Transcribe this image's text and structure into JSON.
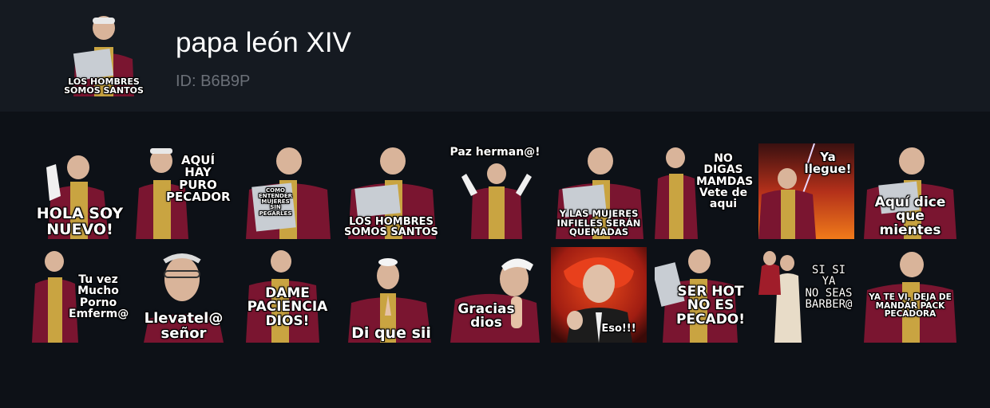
{
  "pack": {
    "title": "papa león XIV",
    "id_label": "ID: B6B9P",
    "cover_caption": "LOS HOMBRES\nSOMOS SANTOS"
  },
  "stickers": [
    {
      "caption": "HOLA SOY\nNUEVO!",
      "icon": "waving-pope"
    },
    {
      "caption": "AQUÍ HAY\nPURO\nPECADOR",
      "icon": "pope-pointing"
    },
    {
      "caption": "COMO\nENTENDER\nMUJERES\nSIN\nPEGARLES",
      "icon": "pope-reading"
    },
    {
      "caption": "LOS HOMBRES\nSOMOS SANTOS",
      "icon": "pope-reading"
    },
    {
      "caption": "Paz herman@!",
      "icon": "pope-arms-raised"
    },
    {
      "caption": "Y LAS MUJERES\nINFIELES SERÁN\nQUEMADAS",
      "icon": "pope-reading"
    },
    {
      "caption": "NO\nDIGAS\nMAMDAS\nVete de\naqui",
      "icon": "pope-standing"
    },
    {
      "caption": "Ya\nllegue!",
      "icon": "pope-fire-background"
    },
    {
      "caption": "Aquí dice\nque\nmientes",
      "icon": "pope-reading"
    },
    {
      "caption": "Tu vez\nMucho\nPorno\nEmferm@",
      "icon": "pope-standing"
    },
    {
      "caption": "Llevatel@\nseñor",
      "icon": "pope-glasses"
    },
    {
      "caption": "DAME\nPACIENCIA\nDIOS!",
      "icon": "pope-frustrated"
    },
    {
      "caption": "Di que sii",
      "icon": "pope-praying"
    },
    {
      "caption": "Gracias\ndios",
      "icon": "pope-bowing"
    },
    {
      "caption": "Eso!!!",
      "icon": "clown-pope-pointing"
    },
    {
      "caption": "SER HOT\nNO ES\nPECADO!",
      "icon": "pope-reading"
    },
    {
      "caption": "SI SI\nYA\nNO SEAS\nBARBER@",
      "icon": "pope-kiss"
    },
    {
      "caption": "YA TE VI, DEJA DE\nMANDAR PACK\nPECADORA",
      "icon": "pope-standing"
    }
  ]
}
